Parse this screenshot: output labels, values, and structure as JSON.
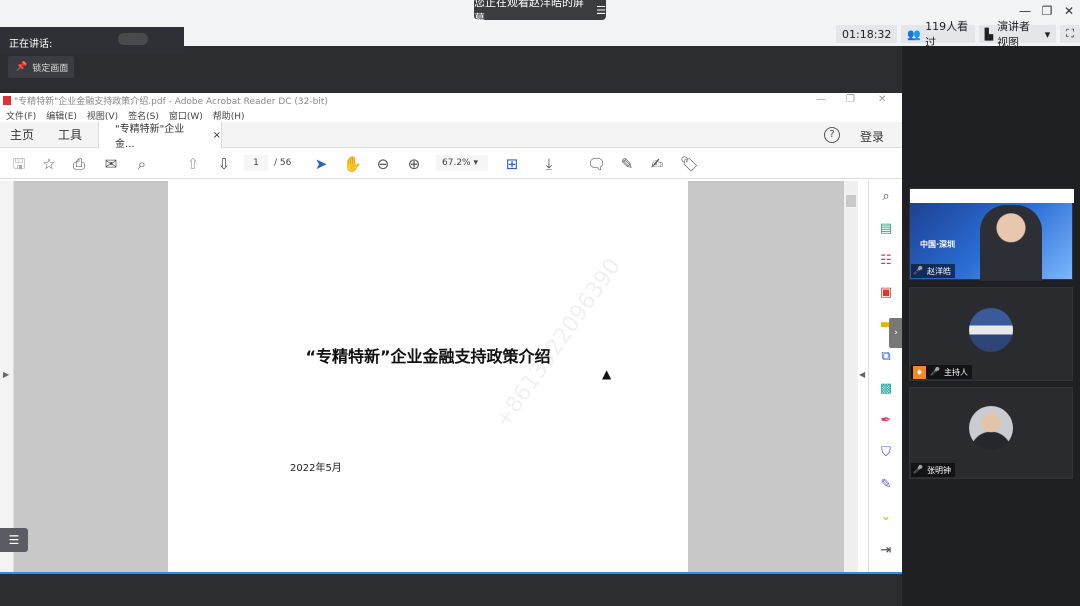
{
  "meeting": {
    "sharing_banner": "您正在观看赵洋皓的屏幕",
    "timer": "01:18:32",
    "viewers": "119人看过",
    "view_mode": "演讲者视图",
    "speaking_label": "正在讲话:",
    "lock_screen": "锁定画面"
  },
  "acrobat": {
    "window_title": "\"专精特新\"企业金融支持政策介绍.pdf - Adobe Acrobat Reader DC (32-bit)",
    "menu": [
      "文件(F)",
      "编辑(E)",
      "视图(V)",
      "签名(S)",
      "窗口(W)",
      "帮助(H)"
    ],
    "tabs": {
      "home": "主页",
      "tools": "工具",
      "doc": "\"专精特新\"企业金..."
    },
    "login": "登录",
    "page_current": "1",
    "page_total": "/ 56",
    "zoom": "67.2%"
  },
  "document": {
    "title": "“专精特新”企业金融支持政策介绍",
    "date": "2022年5月",
    "watermark": "+8613922096390"
  },
  "participants": [
    {
      "name": "赵洋皓",
      "role": ""
    },
    {
      "name": "主持人",
      "role": "host"
    },
    {
      "name": "张明钟",
      "role": ""
    }
  ],
  "video_brand": "中国·深圳"
}
